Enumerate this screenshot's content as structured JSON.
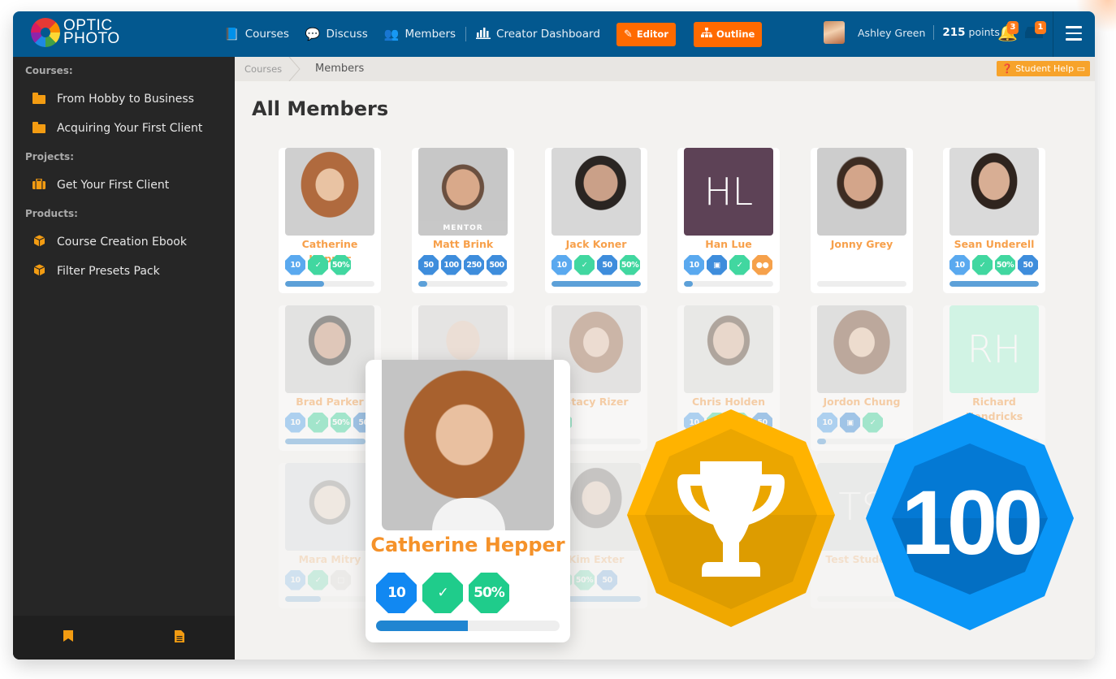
{
  "app": {
    "logo_line1": "OPTIC",
    "logo_line2": "PHOTO"
  },
  "topbar": {
    "nav": [
      {
        "label": "Courses",
        "icon": "book-icon"
      },
      {
        "label": "Discuss",
        "icon": "chat-icon"
      },
      {
        "label": "Members",
        "icon": "users-icon"
      },
      {
        "label": "Creator Dashboard",
        "icon": "bar-chart-icon"
      }
    ],
    "editor_label": "Editor",
    "outline_label": "Outline",
    "user_name": "Ashley Green",
    "points_value": "215",
    "points_label": "points",
    "notifications_count": "3",
    "messages_count": "1",
    "accent_color": "#ff6a00",
    "bar_color": "#03588f"
  },
  "sidebar": {
    "sections": [
      {
        "title": "Courses:",
        "items": [
          {
            "label": "From Hobby to Business",
            "icon": "folder-icon"
          },
          {
            "label": "Acquiring Your First Client",
            "icon": "folder-icon"
          }
        ]
      },
      {
        "title": "Projects:",
        "items": [
          {
            "label": "Get Your First Client",
            "icon": "briefcase-icon"
          }
        ]
      },
      {
        "title": "Products:",
        "items": [
          {
            "label": "Course Creation Ebook",
            "icon": "cube-icon"
          },
          {
            "label": "Filter Presets Pack",
            "icon": "cube-icon"
          }
        ]
      }
    ],
    "footer_icons": [
      "bookmark-icon",
      "document-icon"
    ]
  },
  "breadcrumb": {
    "parent": "Courses",
    "current": "Members",
    "help_label": "Student Help"
  },
  "page": {
    "title": "All Members"
  },
  "members": [
    {
      "name": "Catherine Hepper",
      "badges": [
        "10",
        "task",
        "50%"
      ],
      "progress": 0.44
    },
    {
      "name": "Matt Brink",
      "role": "MENTOR",
      "badges": [
        "50",
        "100",
        "250",
        "500"
      ],
      "progress": 0.1
    },
    {
      "name": "Jack Koner",
      "badges": [
        "10",
        "task",
        "50",
        "50%"
      ],
      "progress": 1.0
    },
    {
      "name": "Han Lue",
      "initials": "HL",
      "badges": [
        "10",
        "camera",
        "task",
        "group"
      ],
      "progress": 0.1
    },
    {
      "name": "Jonny Grey",
      "badges": [],
      "progress": 0
    },
    {
      "name": "Sean Underell",
      "badges": [
        "10",
        "task",
        "50%",
        "50"
      ],
      "progress": 1.0
    },
    {
      "name": "Brad Parker",
      "badges": [
        "10",
        "task",
        "50%",
        "50"
      ],
      "progress": 0.9
    },
    {
      "name": "",
      "badges": [],
      "progress": 0
    },
    {
      "name": "Stacy Rizer",
      "badges": [
        "task"
      ],
      "progress": 0.2
    },
    {
      "name": "Chris Holden",
      "badges": [
        "10",
        "task",
        "50%",
        "50"
      ],
      "progress": 0.9
    },
    {
      "name": "Jordon Chung",
      "badges": [
        "10",
        "camera",
        "task"
      ],
      "progress": 0.1
    },
    {
      "name": "Richard Hendricks",
      "initials": "RH",
      "badges": [],
      "progress": 0
    },
    {
      "name": "Mara Mitry",
      "badges": [
        "10",
        "task",
        "gift"
      ],
      "progress": 0.4
    },
    {
      "name": "Kim Exter",
      "badges": [
        "task",
        "50%",
        "50"
      ],
      "progress": 1.0
    },
    {
      "name": "Test Student",
      "initials": "TS",
      "badges": [],
      "progress": 0
    }
  ],
  "featured": {
    "name": "Catherine Hepper",
    "badges": [
      "10",
      "task",
      "50%"
    ],
    "progress": 0.5
  },
  "highlight_badges": [
    {
      "type": "trophy",
      "icon": "trophy-icon",
      "color": "#ffb300"
    },
    {
      "type": "points",
      "label": "100",
      "color": "#0a96f7"
    }
  ]
}
